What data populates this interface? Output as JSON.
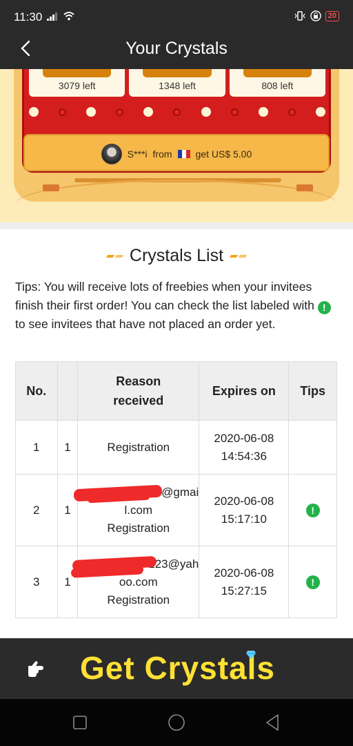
{
  "status_bar": {
    "time": "11:30",
    "battery": "20"
  },
  "header": {
    "title": "Your Crystals"
  },
  "banner": {
    "cards": [
      {
        "left_text": "3079 left"
      },
      {
        "left_text": "1348 left"
      },
      {
        "left_text": "808 left"
      }
    ],
    "ticker": {
      "name": "S***i",
      "from": "from",
      "suffix": "get US$ 5.00"
    }
  },
  "crystals_list": {
    "title": "Crystals List",
    "tips_before": "Tips: You will receive lots of freebies when your invitees finish their first order! You can check the list labeled with",
    "tips_after": "to see invitees that have not placed an order yet.",
    "columns": [
      "No.",
      "",
      "Reason received",
      "Expires on",
      "Tips"
    ],
    "rows": [
      {
        "no": "1",
        "qty": "1",
        "reason_line1": "",
        "reason_line2": "",
        "reason": "Registration",
        "expires_date": "2020-06-08",
        "expires_time": "14:54:36",
        "tip": false
      },
      {
        "no": "2",
        "qty": "1",
        "reason_line1": "no@gmai",
        "reason_line2": "l.com",
        "reason": "Registration",
        "expires_date": "2020-06-08",
        "expires_time": "15:17:10",
        "tip": true
      },
      {
        "no": "3",
        "qty": "1",
        "reason_line1": "123@yah",
        "reason_line2": "oo.com",
        "reason": "Registration",
        "expires_date": "2020-06-08",
        "expires_time": "15:27:15",
        "tip": true
      }
    ]
  },
  "cta": {
    "label": "Get Crystals"
  },
  "colors": {
    "header_bg": "#2a2a2a",
    "cta_text": "#ffe134",
    "tip_green": "#23b24b",
    "banner_red": "#d41e1e"
  }
}
